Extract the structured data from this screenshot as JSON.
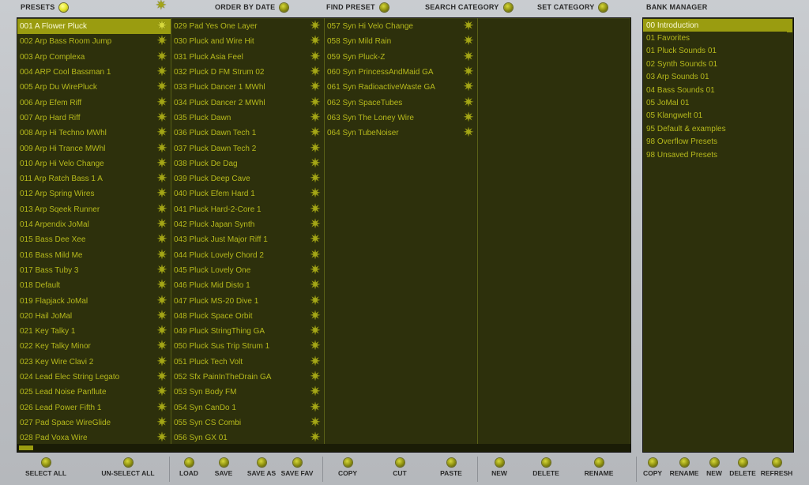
{
  "header": {
    "presets": "PRESETS",
    "order_by_date": "ORDER BY DATE",
    "find_preset": "FIND PRESET",
    "search_category": "SEARCH CATEGORY",
    "set_category": "SET CATEGORY",
    "bank_manager": "BANK MANAGER"
  },
  "presets": {
    "selected": "001 A Flower Pluck",
    "col1": [
      "001 A Flower Pluck",
      "002 Arp Bass Room Jump",
      "003 Arp Complexa",
      "004 ARP Cool Bassman 1",
      "005 Arp Du WirePluck",
      "006 Arp Efem Riff",
      "007 Arp Hard Riff",
      "008 Arp Hi Techno MWhl",
      "009 Arp Hi Trance MWhl",
      "010 Arp Hi Velo Change",
      "011 Arp Ratch Bass 1 A",
      "012 Arp Spring Wires",
      "013 Arp Sqeek Runner",
      "014 Arpendix JoMal",
      "015 Bass Dee Xee",
      "016 Bass Mild Me",
      "017 Bass Tuby 3",
      "018 Default",
      "019 Flapjack JoMal",
      "020 Hail JoMal",
      "021 Key Talky 1",
      "022 Key Talky Minor",
      "023 Key Wire Clavi 2",
      "024 Lead Elec String Legato",
      "025 Lead Noise Panflute",
      "026 Lead Power Fifth 1",
      "027 Pad Space WireGlide",
      "028 Pad Voxa Wire"
    ],
    "col2": [
      "029 Pad Yes One Layer",
      "030 Pluck and Wire Hit",
      "031 Pluck Asia Feel",
      "032 Pluck D FM Strum 02",
      "033 Pluck Dancer 1 MWhl",
      "034 Pluck Dancer 2 MWhl",
      "035 Pluck Dawn",
      "036 Pluck Dawn Tech 1",
      "037 Pluck Dawn Tech 2",
      "038 Pluck De Dag",
      "039 Pluck Deep Cave",
      "040 Pluck Efem Hard 1",
      "041 Pluck Hard-2-Core 1",
      "042 Pluck Japan Synth",
      "043 Pluck Just Major Riff 1",
      "044 Pluck Lovely Chord 2",
      "045 Pluck Lovely One",
      "046 Pluck Mid Disto 1",
      "047 Pluck MS-20 Dive 1",
      "048 Pluck Space Orbit",
      "049 Pluck StringThing GA",
      "050 Pluck Sus Trip Strum 1",
      "051 Pluck Tech Volt",
      "052 Sfx PainInTheDrain GA",
      "053 Syn Body FM",
      "054 Syn CanDo 1",
      "055 Syn CS Combi",
      "056 Syn GX 01"
    ],
    "col3": [
      "057 Syn Hi Velo Change",
      "058 Syn Mild Rain",
      "059 Syn Pluck-Z",
      "060 Syn PrincessAndMaid GA",
      "061 Syn RadioactiveWaste GA",
      "062 Syn SpaceTubes",
      "063 Syn The Loney Wire",
      "064 Syn TubeNoiser"
    ]
  },
  "banks": {
    "selected": "00 Introduction",
    "items": [
      "00 Introduction",
      "01 Favorites",
      "01 Pluck Sounds 01",
      "02 Synth Sounds 01",
      "03 Arp Sounds 01",
      "04 Bass Sounds 01",
      "05 JoMal 01",
      "05 Klangwelt 01",
      "95 Default & examples",
      "98 Overflow Presets",
      "98 Unsaved Presets"
    ]
  },
  "footer": {
    "select_all": "SELECT ALL",
    "unselect_all": "UN-SELECT ALL",
    "load": "LOAD",
    "save": "SAVE",
    "save_as": "SAVE AS",
    "save_fav": "SAVE FAV",
    "copy": "COPY",
    "cut": "CUT",
    "paste": "PASTE",
    "new": "NEW",
    "delete": "DELETE",
    "rename": "RENAME",
    "bank_copy": "COPY",
    "bank_rename": "RENAME",
    "bank_new": "NEW",
    "bank_delete": "DELETE",
    "bank_refresh": "REFRESH"
  },
  "icons": {
    "favorite": "star-icon",
    "indicator": "led-indicator-icon"
  },
  "colors": {
    "panel_bg": "#2d300c",
    "text": "#b6b91c",
    "selected_bg": "#9a9c10",
    "selected_text": "#fbfbd8",
    "chrome_bg": "#c2c5c9"
  }
}
